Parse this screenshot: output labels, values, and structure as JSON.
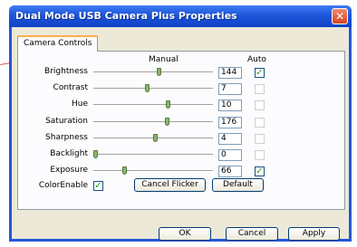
{
  "window": {
    "title": "Dual Mode USB Camera Plus Properties",
    "close_symbol": "✕"
  },
  "tab": {
    "label": "Camera Controls"
  },
  "headers": {
    "manual": "Manual",
    "auto": "Auto"
  },
  "controls": [
    {
      "label": "Brightness",
      "value": "144",
      "slider_fraction": 0.55,
      "auto": true
    },
    {
      "label": "Contrast",
      "value": "7",
      "slider_fraction": 0.45,
      "auto": false
    },
    {
      "label": "Hue",
      "value": "10",
      "slider_fraction": 0.63,
      "auto": false
    },
    {
      "label": "Saturation",
      "value": "176",
      "slider_fraction": 0.62,
      "auto": false
    },
    {
      "label": "Sharpness",
      "value": "4",
      "slider_fraction": 0.52,
      "auto": false
    },
    {
      "label": "Backlight",
      "value": "0",
      "slider_fraction": 0.0,
      "auto": false
    },
    {
      "label": "Exposure",
      "value": "66",
      "slider_fraction": 0.25,
      "auto": true
    }
  ],
  "colorenable": {
    "label": "ColorEnable",
    "checked": true
  },
  "buttons": {
    "cancel_flicker": "Cancel Flicker",
    "default": "Default",
    "ok": "OK",
    "cancel": "Cancel",
    "apply": "Apply"
  }
}
